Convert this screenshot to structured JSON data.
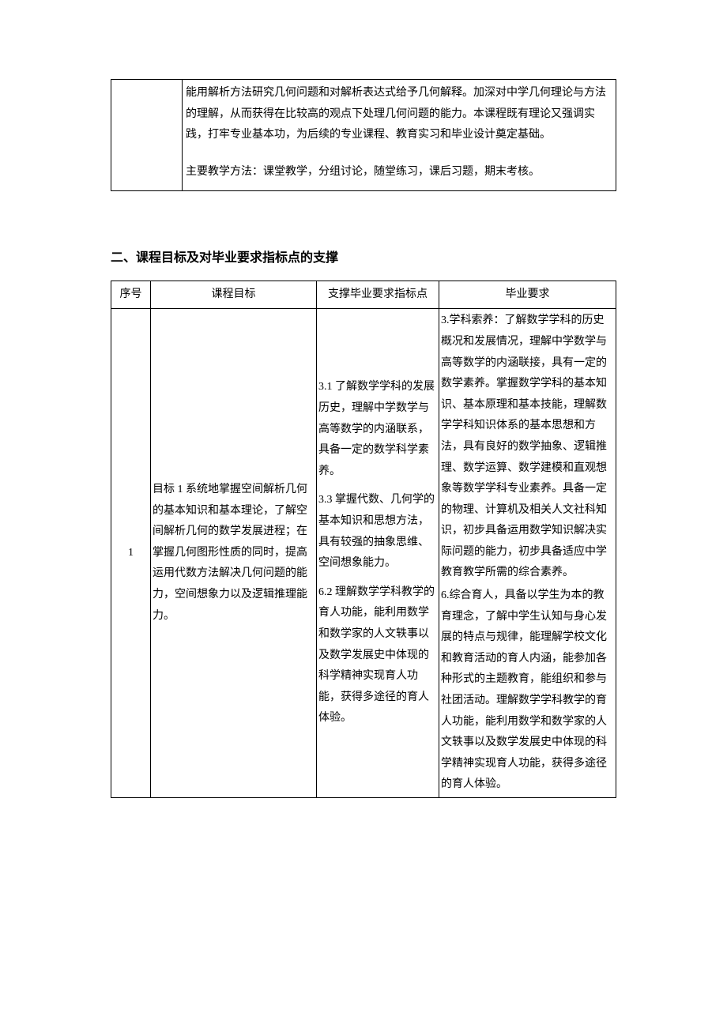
{
  "top_box": {
    "paragraph1": "能用解析方法研究几何问题和对解析表达式给予几何解释。加深对中学几何理论与方法的理解，从而获得在比较高的观点下处理几何问题的能力。本课程既有理论又强调实践，打牢专业基本功，为后续的专业课程、教育实习和毕业设计奠定基础。",
    "paragraph2": "主要教学方法：课堂教学，分组讨论，随堂练习，课后习题，期末考核。"
  },
  "section2": {
    "heading": "二、课程目标及对毕业要求指标点的支撑",
    "headers": {
      "seq": "序号",
      "goal": "课程目标",
      "indicator": "支撑毕业要求指标点",
      "req": "毕业要求"
    },
    "rows": [
      {
        "seq": "1",
        "goal": "目标 1 系统地掌握空间解析几何的基本知识和基本理论，了解空间解析几何的数学发展进程；在掌握几何图形性质的同时，提高运用代数方法解决几何问题的能力，空间想象力以及逻辑推理能力。",
        "indicators": [
          "3.1 了解数学学科的发展历史，理解中学数学与高等数学的内涵联系，具备一定的数学科学素养。",
          "3.3 掌握代数、几何学的基本知识和思想方法，具有较强的抽象思维、空间想象能力。",
          "6.2 理解数学学科教学的育人功能，能利用数学和数学家的人文轶事以及数学发展史中体现的科学精神实现育人功能，获得多途径的育人体验。"
        ],
        "reqs": [
          "3.学科索养：了解数学学科的历史概况和发展情况，理解中学数学与高等数学的内涵联接，具有一定的数学素养。掌握数学学科的基本知识、基本原理和基本技能，理解数学学科知识体系的基本思想和方法，具有良好的数学抽象、逻辑推理、数学运算、数学建模和直观想象等数学学科专业素养。具备一定的物理、计算机及相关人文社科知识，初步具备运用数学知识解决实际问题的能力，初步具备适应中学教育教学所需的综合素养。",
          "6.综合育人，具备以学生为本的教育理念，了解中学生认知与身心发展的特点与规律，能理解学校文化和教育活动的育人内涵，能参加各种形式的主题教育，能组织和参与社团活动。理解数学学科教学的育人功能，能利用数学和数学家的人文轶事以及数学发展史中体现的科学精神实现育人功能，获得多途径的育人体验。"
        ]
      }
    ]
  }
}
